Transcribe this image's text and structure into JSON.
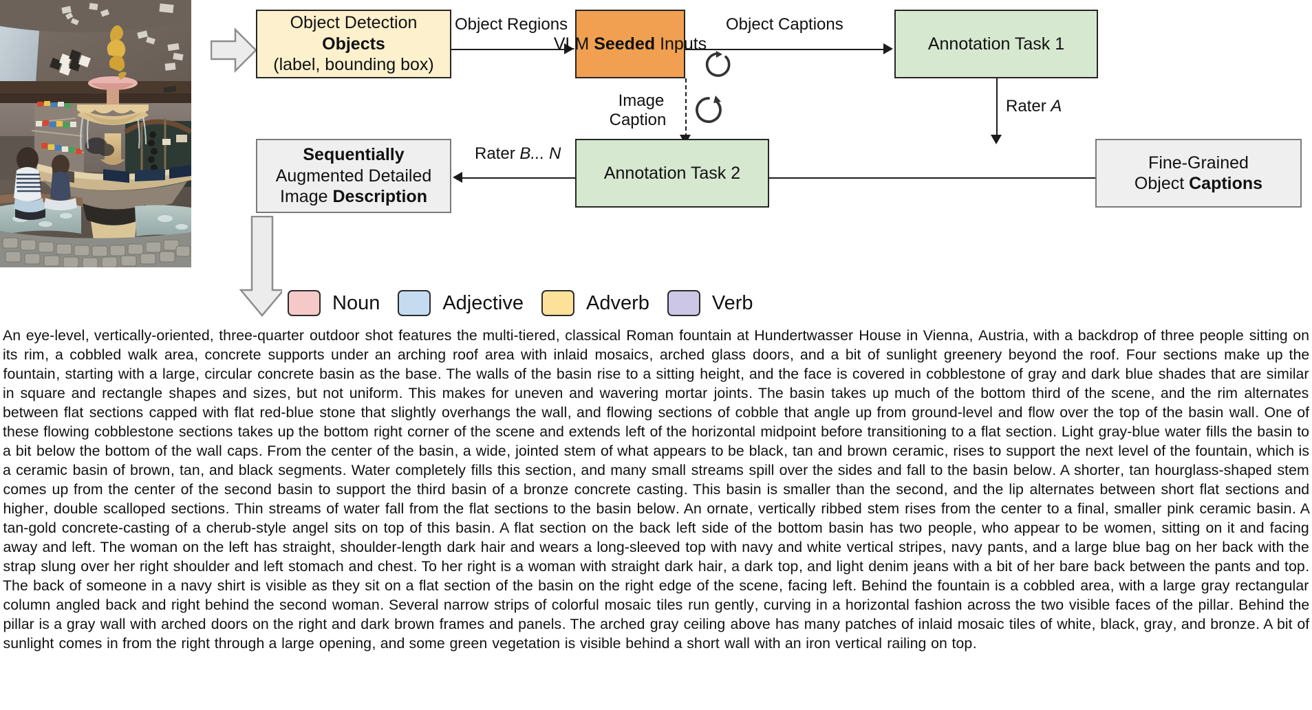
{
  "diagram": {
    "nodes": [
      {
        "id": "object-detection",
        "lines": [
          "Object Detection",
          "Objects",
          "(label, bounding box)"
        ],
        "color": "#fdf0cd"
      },
      {
        "id": "vlm-seeded-inputs",
        "lines": [
          "VLM Seeded Inputs"
        ],
        "color": "#f0a050"
      },
      {
        "id": "annotation-task-1",
        "lines": [
          "Annotation Task 1"
        ],
        "color": "#d6e8d0"
      },
      {
        "id": "fine-grained-object-captions",
        "lines": [
          "Fine-Grained",
          "Object Captions"
        ],
        "color": "#efefef"
      },
      {
        "id": "annotation-task-2",
        "lines": [
          "Annotation Task 2"
        ],
        "color": "#d6e8d0"
      },
      {
        "id": "sequentially-augmented",
        "lines": [
          "Sequentially",
          "Augmented Detailed",
          "Image Description"
        ],
        "color": "#efefef"
      }
    ],
    "node_text": {
      "object_detection_l1": "Object Detection",
      "object_detection_l2": "Objects",
      "object_detection_l3": "(label, bounding box)",
      "vlm_l1a": "VLM ",
      "vlm_l1b": "Seeded",
      "vlm_l1c": " Inputs",
      "annotation_task_1": "Annotation Task 1",
      "fine_grained_l1": "Fine-Grained",
      "fine_grained_l2a": "Object ",
      "fine_grained_l2b": "Captions",
      "annotation_task_2": "Annotation Task 2",
      "seq_l1": "Sequentially",
      "seq_l2": "Augmented Detailed",
      "seq_l3a": "Image ",
      "seq_l3b": "Description"
    },
    "edges": {
      "object_regions": "Object Regions",
      "object_captions": "Object Captions",
      "rater_a_pre": "Rater ",
      "rater_a_em": "A",
      "rater_bn_pre": "Rater ",
      "rater_bn_em": "B... N",
      "image_caption_l1": "Image",
      "image_caption_l2": "Caption"
    }
  },
  "legend": {
    "items": [
      {
        "label": "Noun",
        "color": "#f6c9c9"
      },
      {
        "label": "Adjective",
        "color": "#c5dcf0"
      },
      {
        "label": "Adverb",
        "color": "#fbe19a"
      },
      {
        "label": "Verb",
        "color": "#ccc7e6"
      }
    ]
  },
  "paragraph": {
    "text": "An eye-level, vertically-oriented, three-quarter outdoor shot features the multi-tiered, classical Roman fountain at Hundertwasser House in Vienna, Austria, with a backdrop of three people sitting on its rim, a cobbled walk area, concrete supports under an arching roof area with inlaid mosaics, arched glass doors, and a bit of sunlight greenery beyond the roof. Four sections make up the fountain, starting with a large, circular concrete basin as the base. The walls of the basin rise to a sitting height, and the face is covered in cobblestone of gray and dark blue shades that are similar in square and rectangle shapes and sizes, but not uniform. This makes for uneven and wavering mortar joints. The basin takes up much of the bottom third of the scene, and the rim alternates between flat sections capped with flat red-blue stone that slightly overhangs the wall, and flowing sections of cobble that angle up from ground-level and flow over the top of the basin wall. One of these flowing cobblestone sections takes up the bottom right corner of the scene and extends left of the horizontal midpoint before transitioning to a flat section. Light gray-blue water fills the basin to a bit below the bottom of the wall caps. From the center of the basin, a wide, jointed stem of what appears to be black, tan and brown ceramic, rises to support the next level of the fountain, which is a ceramic basin of brown, tan, and black segments. Water completely fills this section, and many small streams spill over the sides and fall to the basin below. A shorter, tan hourglass-shaped stem comes up from the center of the second basin to support the third basin of a bronze concrete casting. This basin is smaller than the second, and the lip alternates between short flat sections and higher, double scalloped sections. Thin streams of water fall from the flat sections to the basin below. An ornate, vertically ribbed stem rises from the center to a final, smaller pink ceramic basin. A tan-gold concrete-casting of a cherub-style angel sits on top of this basin. A flat section on the back left side of the bottom basin has two people, who appear to be women, sitting on it and facing away and left. The woman on the left has straight, shoulder-length dark hair and wears a long-sleeved top with navy and white vertical stripes, navy pants, and a large blue bag on her back with the strap slung over her right shoulder and left stomach and chest. To her right is a woman with straight dark hair, a dark top, and light denim jeans with a bit of her bare back between the pants and top. The back of someone in a navy shirt is visible as they sit on a flat section of the basin on the right edge of the scene, facing left. Behind the fountain is a cobbled area, with a large gray rectangular column angled back and right behind the second woman. Several narrow strips of colorful mosaic tiles run gently, curving in a horizontal fashion across the two visible faces of the pillar. Behind the pillar is a gray wall with arched doors on the right and dark brown frames and panels. The arched gray ceiling above has many patches of inlaid mosaic tiles of white, black, gray, and bronze. A bit of sunlight comes in from the right through a large opening, and some green vegetation is visible behind a short wall with an iron vertical railing on top."
  },
  "photo": {
    "alt": "multi-tiered classical Roman fountain at Hundertwasser House, Vienna, Austria, with people sitting on the rim"
  },
  "colors": {
    "noun": "#f6c9c9",
    "adjective": "#c5dcf0",
    "adverb": "#fbe19a",
    "verb": "#ccc7e6",
    "node_yellow": "#fdf0cd",
    "node_orange": "#f0a050",
    "node_green": "#d6e8d0",
    "node_gray": "#efefef"
  }
}
